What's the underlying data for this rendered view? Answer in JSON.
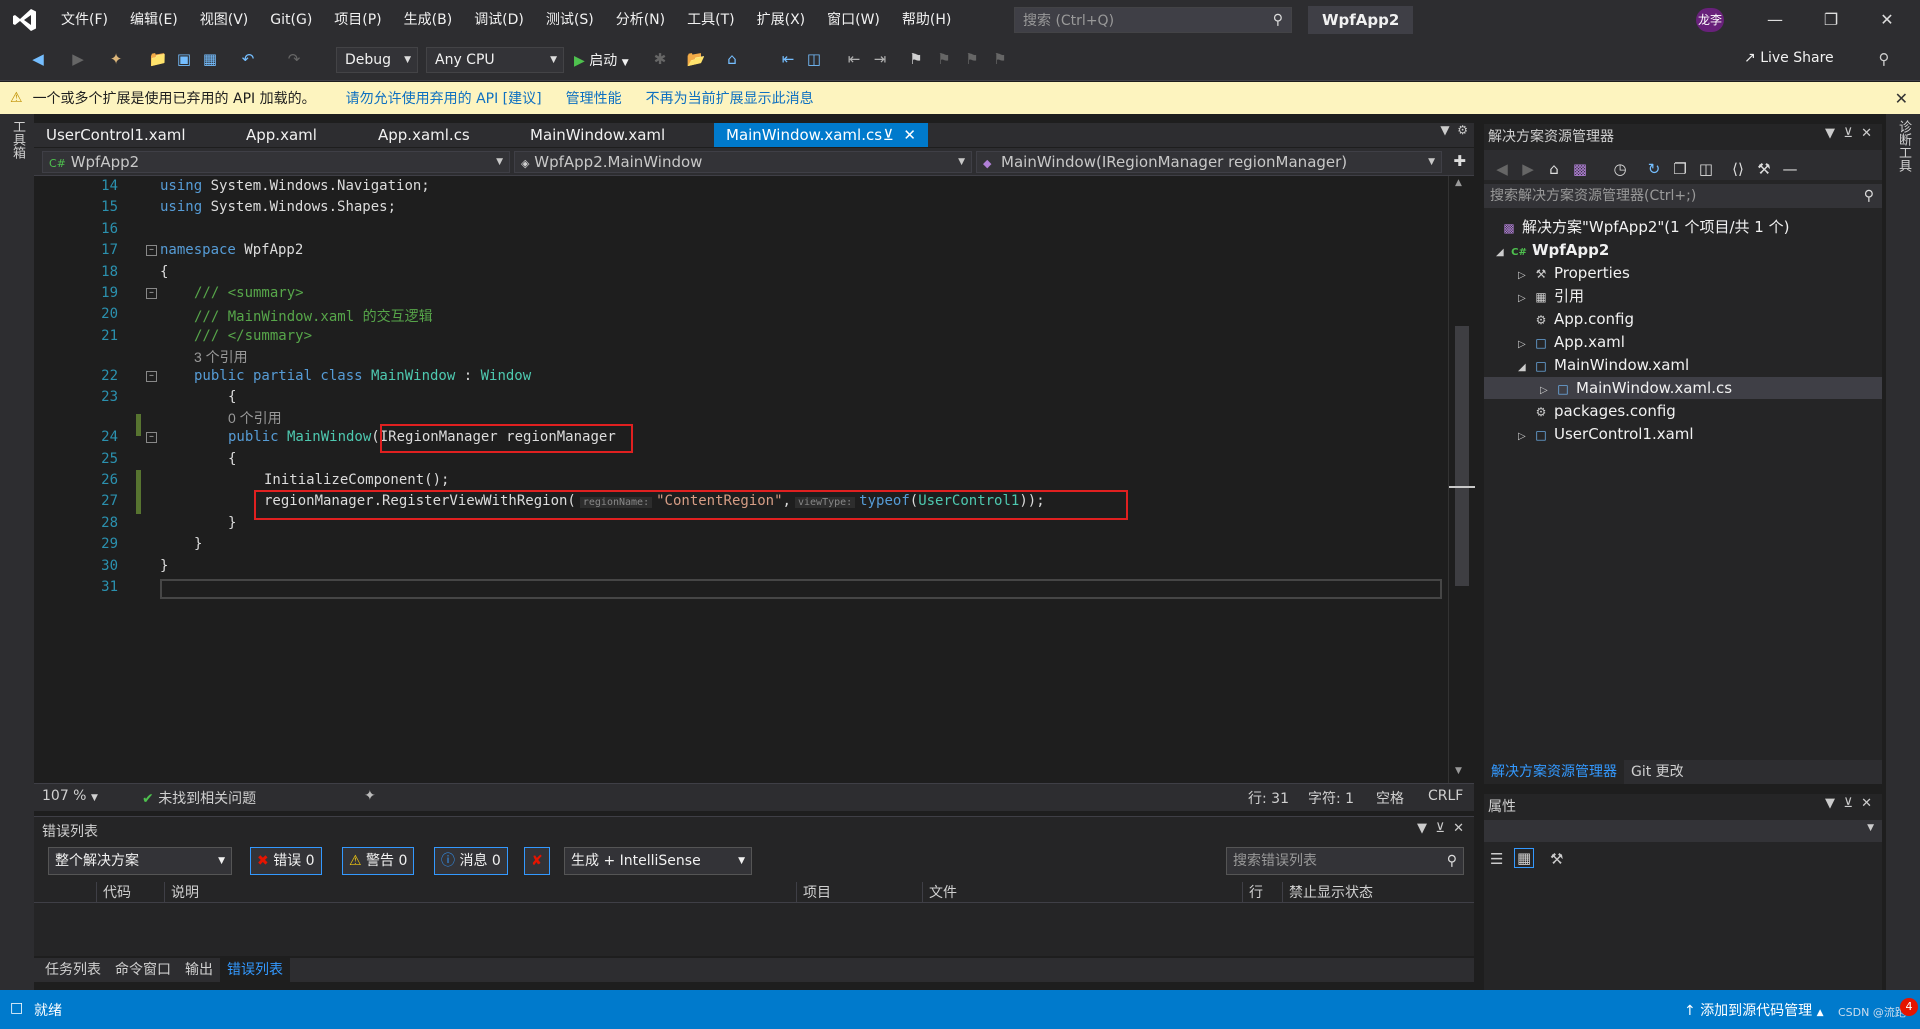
{
  "menu": [
    "文件(F)",
    "编辑(E)",
    "视图(V)",
    "Git(G)",
    "项目(P)",
    "生成(B)",
    "调试(D)",
    "测试(S)",
    "分析(N)",
    "工具(T)",
    "扩展(X)",
    "窗口(W)",
    "帮助(H)"
  ],
  "search": {
    "placeholder": "搜索 (Ctrl+Q)"
  },
  "app_name": "WpfApp2",
  "user_badge": "龙李",
  "toolbar": {
    "config": "Debug",
    "platform": "Any CPU",
    "start": "启动",
    "live_share": "Live Share"
  },
  "infobar": {
    "message": "一个或多个扩展是使用已弃用的 API 加载的。",
    "link1": "请勿允许使用弃用的 API [建议]",
    "link2": "管理性能",
    "link3": "不再为当前扩展显示此消息"
  },
  "left_tool": "工具箱",
  "right_tool": "诊断工具",
  "doc_tabs": [
    "UserControl1.xaml",
    "App.xaml",
    "App.xaml.cs",
    "MainWindow.xaml",
    "MainWindow.xaml.cs"
  ],
  "nav": {
    "project": "WpfApp2",
    "class": "WpfApp2.MainWindow",
    "member": "MainWindow(IRegionManager regionManager)"
  },
  "code": {
    "l14_kw": "using",
    "l14": " System.Windows.Navigation;",
    "l15_kw": "using",
    "l15": " System.Windows.Shapes;",
    "l17_kw": "namespace",
    "l17": " WpfApp2",
    "brace_open": "{",
    "l19": "/// <summary>",
    "l20": "/// MainWindow.xaml 的交互逻辑",
    "l21": "/// </summary>",
    "refs3": "3 个引用",
    "l22_kw": "public partial class",
    "l22_name": " MainWindow",
    "l22_sep": " : ",
    "l22_base": "Window",
    "refs0": "0 个引用",
    "l24_kw": "public",
    "l24_name": " MainWindow",
    "l24_paren": "(",
    "l24_param_type": "IRegionManager",
    "l24_param": " regionManager",
    "l26": "InitializeComponent();",
    "l27_obj": "regionManager.RegisterViewWithRegion(",
    "l27_h1": "regionName:",
    "l27_str": "\"ContentRegion\"",
    "l27_comma": ",",
    "l27_h2": "viewType:",
    "l27_kw": "typeof",
    "l27_open": "(",
    "l27_type": "UserControl1",
    "l27_close": "));",
    "brace_close": "}",
    "line_numbers": [
      "14",
      "15",
      "16",
      "17",
      "18",
      "19",
      "20",
      "21",
      "22",
      "23",
      "24",
      "25",
      "26",
      "27",
      "28",
      "29",
      "30",
      "31"
    ]
  },
  "editor_status": {
    "zoom": "107 %",
    "issues": "未找到相关问题",
    "line": "行: 31",
    "char": "字符: 1",
    "spaces": "空格",
    "eol": "CRLF"
  },
  "error_list": {
    "title": "错误列表",
    "scope": "整个解决方案",
    "errors": "错误 0",
    "warnings": "警告 0",
    "messages": "消息 0",
    "build": "生成 + IntelliSense",
    "search": "搜索错误列表",
    "cols": [
      "代码",
      "说明",
      "项目",
      "文件",
      "行",
      "禁止显示状态"
    ]
  },
  "panel_tabs": [
    "任务列表",
    "命令窗口",
    "输出",
    "错误列表"
  ],
  "solution_explorer": {
    "title": "解决方案资源管理器",
    "search": "搜索解决方案资源管理器(Ctrl+;)",
    "solution": "解决方案\"WpfApp2\"(1 个项目/共 1 个)",
    "project": "WpfApp2",
    "items": [
      "Properties",
      "引用",
      "App.config",
      "App.xaml",
      "MainWindow.xaml",
      "MainWindow.xaml.cs",
      "packages.config",
      "UserControl1.xaml"
    ],
    "tabs": [
      "解决方案资源管理器",
      "Git 更改"
    ]
  },
  "properties": {
    "title": "属性"
  },
  "status": {
    "ready": "就绪",
    "source_control": "添加到源代码管理",
    "watermark": "CSDN @流跑",
    "badge": "4"
  },
  "colors": {
    "accent": "#007acc",
    "chrome": "#2d2d30",
    "editor": "#1e1e1e",
    "highlight": "#e02020",
    "info": "#fdf4bf"
  }
}
